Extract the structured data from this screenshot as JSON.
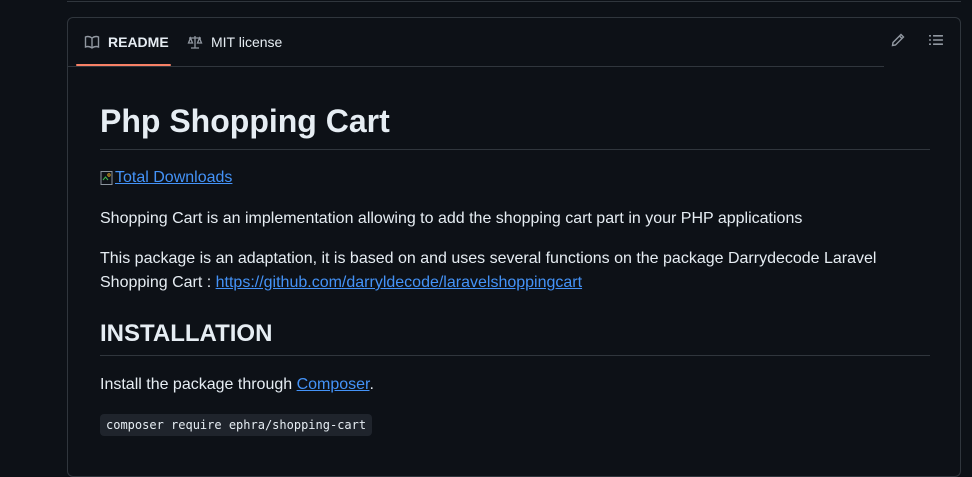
{
  "tabs": {
    "readme": "README",
    "license": "MIT license"
  },
  "readme": {
    "title": "Php Shopping Cart",
    "badge_text": "Total Downloads",
    "intro": "Shopping Cart is an implementation allowing to add the shopping cart part in your PHP applications",
    "adaptation_line1": "This package is an adaptation, it is based on and uses several functions on the package Darrydecode Laravel",
    "adaptation_line2_prefix": "Shopping Cart : ",
    "adaptation_link": "https://github.com/darryldecode/laravelshoppingcart",
    "installation_heading": "INSTALLATION",
    "install_prefix": "Install the package through ",
    "install_link": "Composer",
    "install_suffix": ".",
    "command": "composer require ephra/shopping-cart"
  },
  "icons": {
    "readme_tab": "book-icon",
    "license_tab": "scale-icon",
    "edit": "pencil-icon",
    "toc": "list-icon"
  },
  "colors": {
    "background": "#0d1117",
    "border": "#30363d",
    "text": "#e6edf3",
    "link": "#4493f8",
    "active_tab_underline": "#f78166",
    "code_bg": "#1f242c"
  }
}
